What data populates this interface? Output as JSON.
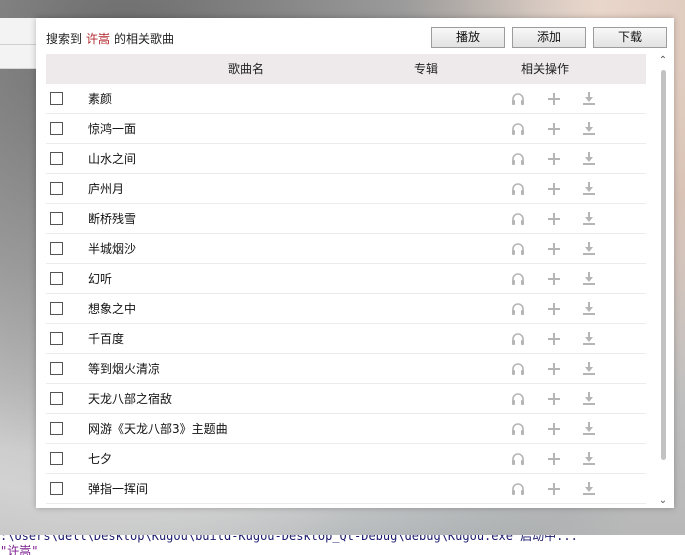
{
  "header": {
    "prefix": "搜索到",
    "keyword": "许嵩",
    "suffix": "的相关歌曲"
  },
  "toolbar": {
    "play_label": "播放",
    "add_label": "添加",
    "download_label": "下载"
  },
  "table": {
    "columns": {
      "name": "歌曲名",
      "album": "专辑",
      "actions": "相关操作"
    },
    "rows": [
      {
        "title": "素颜"
      },
      {
        "title": "惊鸿一面"
      },
      {
        "title": "山水之间"
      },
      {
        "title": "庐州月"
      },
      {
        "title": "断桥残雪"
      },
      {
        "title": "半城烟沙"
      },
      {
        "title": "幻听"
      },
      {
        "title": "想象之中"
      },
      {
        "title": "千百度"
      },
      {
        "title": "等到烟火清凉"
      },
      {
        "title": "天龙八部之宿敌"
      },
      {
        "title": "网游《天龙八部3》主题曲"
      },
      {
        "title": "七夕"
      },
      {
        "title": "弹指一挥间"
      }
    ],
    "row_icons": [
      "headphones-icon",
      "plus-icon",
      "download-icon"
    ],
    "icon_color": "#b5b5b5"
  },
  "background": {
    "right_fragment": "",
    "console_line1": ":\\Users\\dell\\Desktop\\Kugou\\build-Kugou-Desktop_Qt-Debug\\debug\\Kugou.exe 启动中...",
    "console_line2": "\"许嵩\""
  },
  "colors": {
    "keyword": "#b3262b",
    "header_bg": "#eeeaec",
    "scroll_thumb": "#c2c2c2"
  }
}
